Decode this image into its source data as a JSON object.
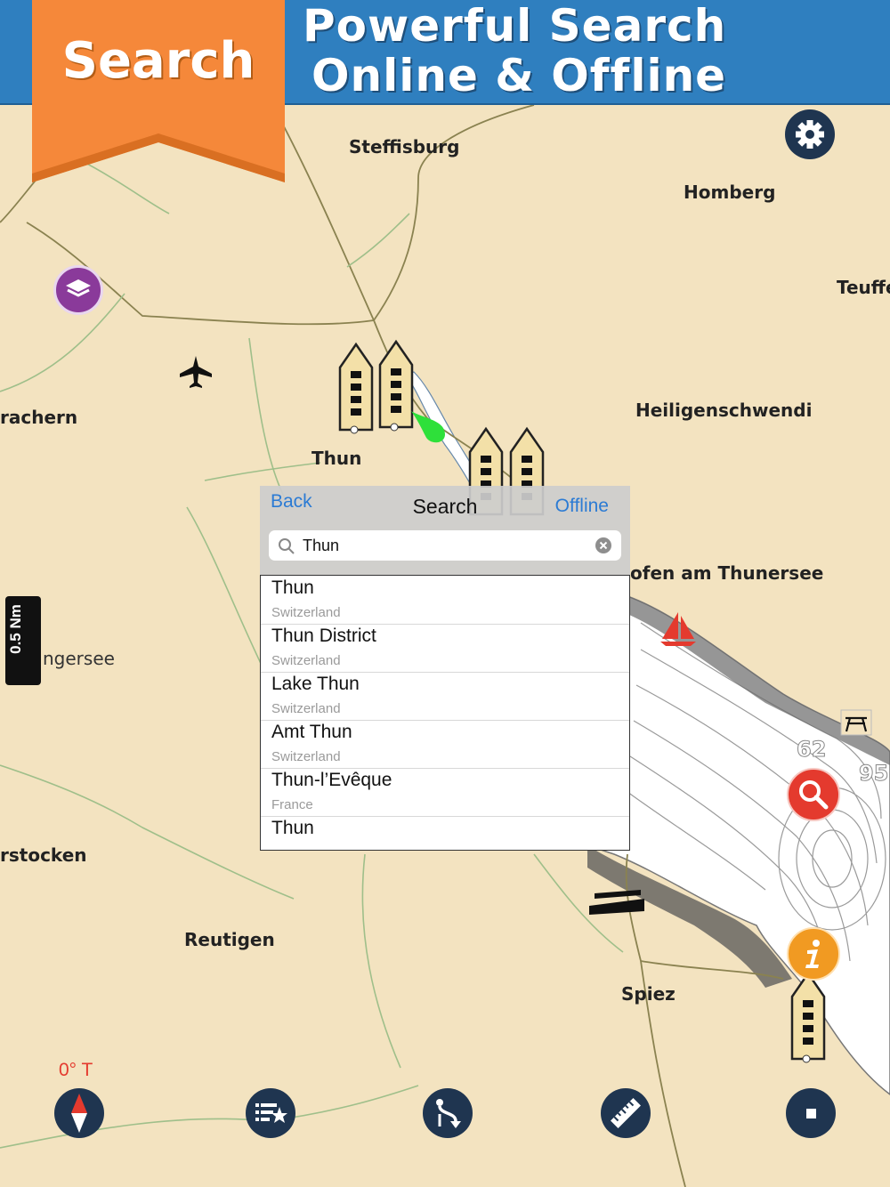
{
  "banner": {
    "ribbon_label": "Search",
    "headline_line1": "Powerful Search",
    "headline_line2": "Online & Offline",
    "ribbon_color": "#f5883a",
    "banner_color": "#2f7fbf"
  },
  "map": {
    "places": {
      "steffisburg": "Steffisburg",
      "homberg": "Homberg",
      "teuffenthal": "Teuffe",
      "rachern": "rachern",
      "heiligenschwendi": "Heiligenschwendi",
      "thun": "Thun",
      "hofen": "ofen am Thunersee",
      "ngersee": "ngersee",
      "rstocken": "rstocken",
      "reutigen": "Reutigen",
      "spiez": "Spiez"
    },
    "depth_labels": [
      "62",
      "95"
    ],
    "scale_label": "0.5 Nm",
    "heading_label": "0° T"
  },
  "search": {
    "back_label": "Back",
    "title": "Search",
    "offline_label": "Offline",
    "query": "Thun",
    "results": [
      {
        "name": "Thun",
        "country": "Switzerland"
      },
      {
        "name": "Thun District",
        "country": "Switzerland"
      },
      {
        "name": "Lake Thun",
        "country": "Switzerland"
      },
      {
        "name": "Amt Thun",
        "country": "Switzerland"
      },
      {
        "name": "Thun-l’Evêque",
        "country": "France"
      },
      {
        "name": "Thun",
        "country": ""
      }
    ]
  },
  "icons": {
    "settings": "gear-icon",
    "layers": "layers-icon",
    "search": "magnifier-icon",
    "info": "info-icon",
    "compass": "compass-icon",
    "favorites": "favorites-list-icon",
    "route": "route-icon",
    "ruler": "ruler-icon",
    "stop": "stop-icon",
    "colors": {
      "dark_button": "#1f3550",
      "purple": "#8a3a9a",
      "red": "#e43a2e",
      "orange": "#f19a22"
    }
  }
}
